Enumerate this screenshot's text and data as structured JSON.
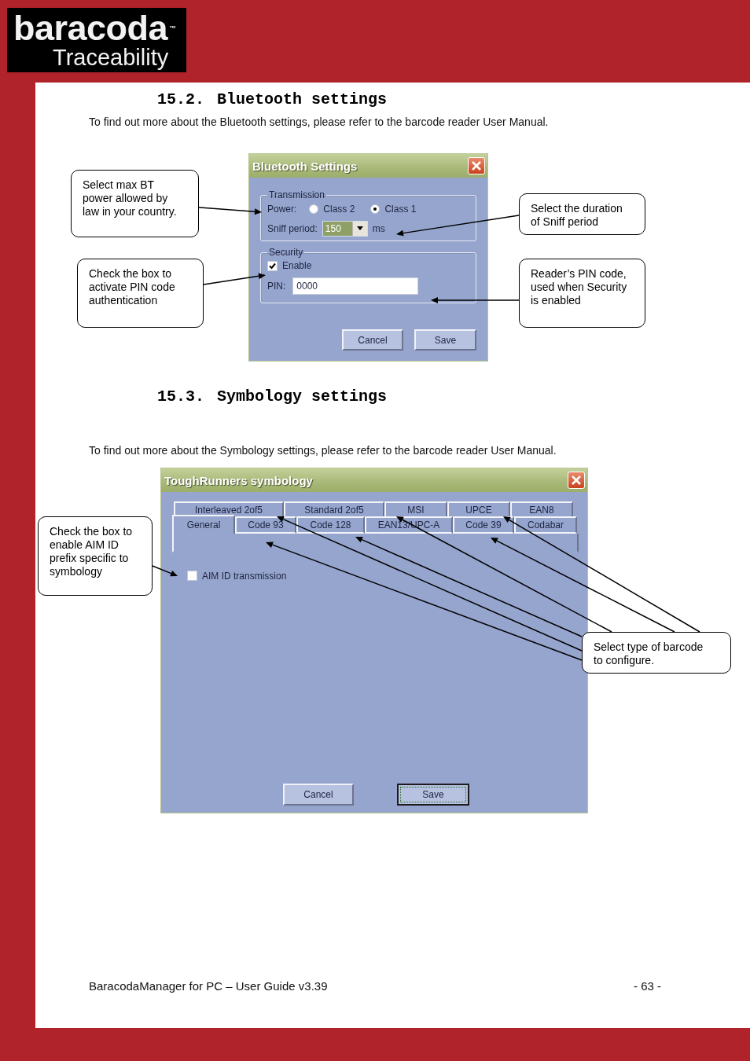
{
  "logo": {
    "name": "baracoda",
    "trademark": "™",
    "tagline": "Traceability"
  },
  "sections": [
    {
      "number": "15.2.",
      "title": "Bluetooth settings",
      "intro": "To find out more about the Bluetooth settings, please refer to the barcode reader User Manual.",
      "dialog": {
        "kind": "bluetooth",
        "title": "Bluetooth Settings",
        "transmission": {
          "legend": "Transmission",
          "power_label": "Power:",
          "options": [
            {
              "label": "Class 2",
              "selected": false
            },
            {
              "label": "Class 1",
              "selected": true
            }
          ],
          "sniff_label": "Sniff period:",
          "sniff_value": "150",
          "unit": "ms"
        },
        "security": {
          "legend": "Security",
          "enable": {
            "label": "Enable",
            "checked": true
          },
          "pin_label": "PIN:",
          "pin_value": "0000"
        },
        "buttons": [
          {
            "label": "Cancel",
            "focused": false
          },
          {
            "label": "Save",
            "focused": false
          }
        ]
      },
      "callouts": [
        {
          "text": "Select max BT power allowed by law in your  country."
        },
        {
          "text": "Select the duration of Sniff period"
        },
        {
          "text": "Check the box to activate PIN code authentication"
        },
        {
          "text": "Reader’s PIN code, used when Security is enabled"
        }
      ]
    },
    {
      "number": "15.3.",
      "title": "Symbology settings",
      "intro": "To find out more about the Symbology settings, please refer to the barcode reader User Manual.",
      "dialog": {
        "kind": "symbology",
        "title": "ToughRunners symbology",
        "tab_rows": [
          [
            {
              "label": "Interleaved 2of5",
              "selected": false
            },
            {
              "label": "Standard 2of5",
              "selected": false
            },
            {
              "label": "MSI",
              "selected": false
            },
            {
              "label": "UPCE",
              "selected": false
            },
            {
              "label": "EAN8",
              "selected": false
            }
          ],
          [
            {
              "label": "General",
              "selected": true
            },
            {
              "label": "Code 93",
              "selected": false
            },
            {
              "label": "Code 128",
              "selected": false
            },
            {
              "label": "EAN13/UPC-A",
              "selected": false
            },
            {
              "label": "Code 39",
              "selected": false
            },
            {
              "label": "Codabar",
              "selected": false
            }
          ]
        ],
        "aim": {
          "label": "AIM ID transmission",
          "checked": false
        },
        "buttons": [
          {
            "label": "Cancel",
            "focused": false
          },
          {
            "label": "Save",
            "focused": true
          }
        ]
      },
      "callouts": [
        {
          "text": "Check the box to enable AIM ID prefix specific to symbology"
        },
        {
          "text": "Select type of barcode to configure."
        }
      ]
    }
  ],
  "footer": {
    "title": "BaracodaManager for PC – User Guide v3.39",
    "page": "- 63 -"
  }
}
